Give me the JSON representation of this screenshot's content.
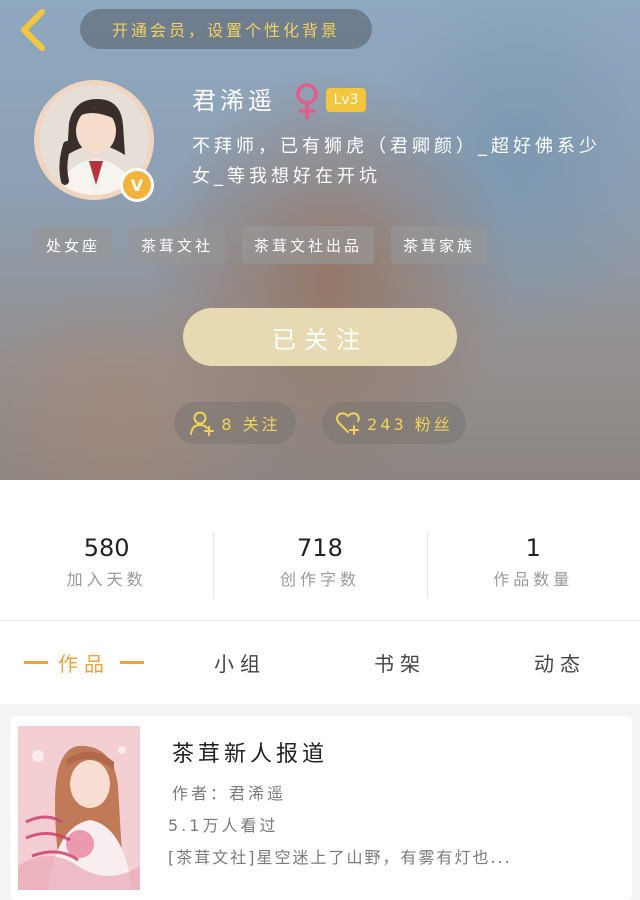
{
  "header": {
    "back_icon": "chevron-left-icon",
    "vip_banner": "开通会员，设置个性化背景",
    "accent_color": "#f2d35a"
  },
  "profile": {
    "username": "君浠遥",
    "gender_icon": "female-symbol-icon",
    "level": "Lv3",
    "verified_badge": "V",
    "bio": "不拜师，已有狮虎（君卿颜）_超好佛系少女_等我想好在开坑",
    "tags": [
      "处女座",
      "茶茸文社",
      "茶茸文社出品",
      "茶茸家族"
    ],
    "follow_button": "已关注",
    "following": "8 关注",
    "fans": "243 粉丝"
  },
  "stats": [
    {
      "value": "580",
      "label": "加入天数"
    },
    {
      "value": "718",
      "label": "创作字数"
    },
    {
      "value": "1",
      "label": "作品数量"
    }
  ],
  "tabs": [
    "作品",
    "小组",
    "书架",
    "动态"
  ],
  "active_tab": "作品",
  "works": [
    {
      "title": "茶茸新人报道",
      "author": "作者：君浠遥",
      "views": "5.1万人看过",
      "description": "[茶茸文社]星空迷上了山野，有雾有灯也..."
    }
  ]
}
